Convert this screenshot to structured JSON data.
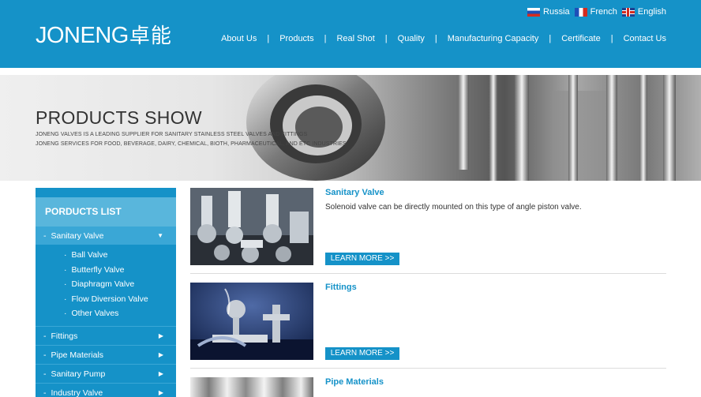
{
  "header": {
    "logo_latin": "JONENG",
    "logo_cn": "卓能",
    "languages": [
      {
        "label": "Russia",
        "flag": "flag-ru"
      },
      {
        "label": "French",
        "flag": "flag-fr"
      },
      {
        "label": "English",
        "flag": "flag-uk"
      }
    ],
    "nav": [
      "About Us",
      "Products",
      "Real Shot",
      "Quality",
      "Manufacturing Capacity",
      "Certificate",
      "Contact Us"
    ],
    "nav_separator": "|"
  },
  "banner": {
    "title": "PRODUCTS SHOW",
    "line1": "JONENG VALVES IS A LEADING SUPPLIER FOR SANITARY STAINLESS STEEL VALVES AND FITTINGS",
    "line2": "JONENG SERVICES FOR FOOD, BEVERAGE, DAIRY, CHEMICAL, BIOTH, PHARMACEUTICAL, AND ETC INDUSTRIES"
  },
  "sidebar": {
    "title": "PORDUCTS LIST",
    "dash": "-",
    "dot": "·",
    "active": {
      "label": "Sanitary Valve",
      "caret": "▼"
    },
    "subitems": [
      "Ball Valve",
      "Butterfly Valve",
      "Diaphragm Valve",
      "Flow Diversion Valve",
      "Other Valves"
    ],
    "categories": [
      {
        "label": "Fittings",
        "caret": "▶"
      },
      {
        "label": "Pipe Materials",
        "caret": "▶"
      },
      {
        "label": "Sanitary Pump",
        "caret": "▶"
      },
      {
        "label": "Industry Valve",
        "caret": "▶"
      }
    ]
  },
  "products": [
    {
      "title": "Sanitary Valve",
      "desc": "Solenoid valve can be directly mounted on this type of angle piston valve.",
      "button": "LEARN MORE >>"
    },
    {
      "title": "Fittings",
      "desc": "",
      "button": "LEARN MORE >>"
    },
    {
      "title": "Pipe Materials",
      "desc": "",
      "button": ""
    }
  ],
  "colors": {
    "brand": "#1592c8",
    "sidebar_title": "#59b6dc",
    "active_item": "#3aa7d6"
  }
}
